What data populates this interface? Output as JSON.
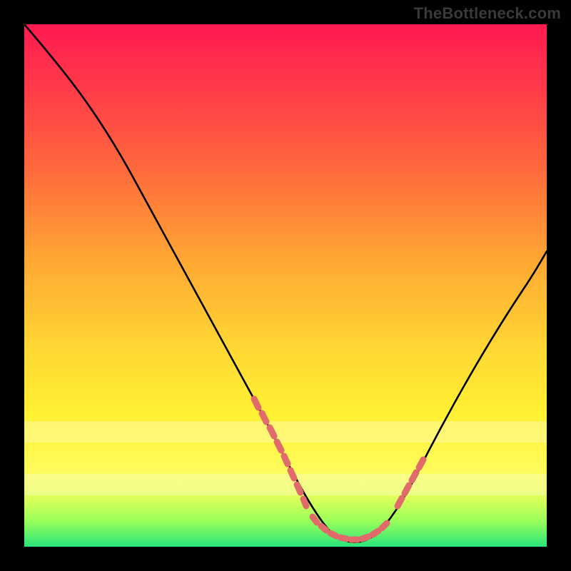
{
  "watermark": "TheBottleneck.com",
  "colors": {
    "frame": "#000000",
    "gradient_top": "#ff1a50",
    "gradient_mid1": "#ffa733",
    "gradient_mid2": "#fff233",
    "gradient_bottom": "#29e57a",
    "curve": "#000000",
    "markers": "#e16a6a"
  },
  "chart_data": {
    "type": "line",
    "title": "",
    "xlabel": "",
    "ylabel": "",
    "xlim": [
      0,
      100
    ],
    "ylim": [
      0,
      100
    ],
    "grid": false,
    "legend": false,
    "series": [
      {
        "name": "bottleneck-curve",
        "x": [
          0,
          6,
          12,
          18,
          24,
          30,
          36,
          42,
          48,
          52,
          56,
          58,
          60,
          62,
          64,
          66,
          70,
          74,
          80,
          86,
          92,
          100
        ],
        "values": [
          100,
          93,
          85,
          76,
          67,
          57,
          46,
          35,
          23,
          15,
          8,
          5,
          3,
          2,
          2,
          4,
          9,
          16,
          26,
          37,
          47,
          58
        ]
      }
    ],
    "marker_clusters": [
      {
        "name": "left-descent-cluster",
        "x": [
          44,
          45.5,
          47,
          48,
          49,
          50,
          51,
          52
        ],
        "values": [
          29,
          25,
          21,
          18,
          15,
          12,
          10,
          8
        ]
      },
      {
        "name": "valley-cluster",
        "x": [
          55,
          57,
          58.5,
          60,
          61.5,
          63,
          64.5,
          66,
          67.5
        ],
        "values": [
          5,
          3.5,
          2.5,
          2,
          2,
          2.5,
          3,
          4,
          6
        ]
      },
      {
        "name": "right-ascent-cluster",
        "x": [
          70,
          71.5,
          73,
          74.5
        ],
        "values": [
          10,
          12.5,
          15,
          17.5
        ]
      }
    ],
    "pale_bands_y": [
      {
        "from": 20,
        "to": 24
      },
      {
        "from": 10,
        "to": 14
      }
    ]
  }
}
